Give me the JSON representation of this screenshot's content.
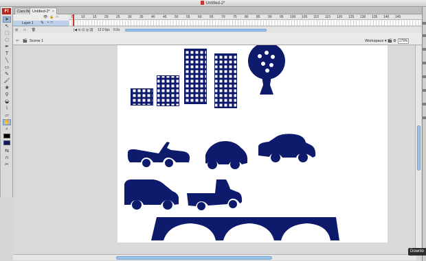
{
  "window": {
    "title": "Untitled-2*"
  },
  "app_logo": "Fl",
  "tabs": [
    {
      "label": "Cars.fla*",
      "active": false
    },
    {
      "label": "Untitled-2*",
      "active": true,
      "close": "×"
    }
  ],
  "timeline": {
    "frame_numbers": [
      "5",
      "10",
      "15",
      "20",
      "25",
      "30",
      "35",
      "40",
      "45",
      "50",
      "55",
      "60",
      "65",
      "70",
      "75",
      "80",
      "85",
      "90",
      "95",
      "100",
      "105",
      "110",
      "115",
      "120",
      "125",
      "130",
      "135",
      "140",
      "145"
    ],
    "layer_name": "Layer 1",
    "current_frame": "1",
    "frame_rate": "12.0 fps",
    "elapsed_time": "0.0s"
  },
  "editbar": {
    "scene_label": "Scene 1",
    "workspace_label": "Workspace ▾",
    "zoom": "179%"
  },
  "tools": [
    "arrow-tool",
    "subselect-tool",
    "free-transform-tool",
    "lasso-tool",
    "pen-tool",
    "text-tool",
    "line-tool",
    "rect-tool",
    "pencil-tool",
    "brush-tool",
    "deco-tool",
    "bone-tool",
    "paint-bucket-tool",
    "eyedropper-tool",
    "eraser-tool",
    "hand-tool",
    "zoom-tool"
  ],
  "colors": {
    "shape_fill": "#0e1a6b",
    "stage_bg": "#ffffff",
    "stroke_color": "#000000",
    "fill_color": "#0e1a6b"
  },
  "tooltip": {
    "label": "Downlo"
  }
}
